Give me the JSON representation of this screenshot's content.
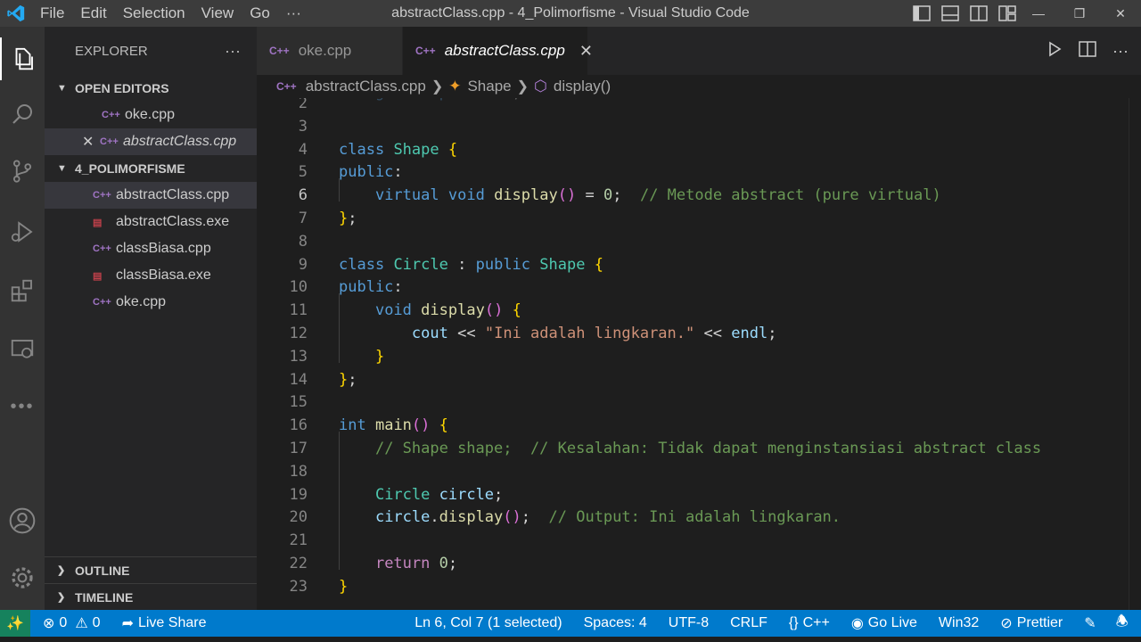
{
  "window": {
    "title": "abstractClass.cpp - 4_Polimorfisme - Visual Studio Code",
    "menu": [
      "File",
      "Edit",
      "Selection",
      "View",
      "Go",
      "···"
    ]
  },
  "sidebar": {
    "header": "EXPLORER",
    "more": "···",
    "open_editors_title": "OPEN EDITORS",
    "open_editors": [
      {
        "name": "oke.cpp",
        "icon": "cpp-file-icon"
      },
      {
        "name": "abstractClass.cpp",
        "icon": "cpp-file-icon"
      }
    ],
    "folder_title": "4_POLIMORFISME",
    "files": [
      {
        "name": "abstractClass.cpp",
        "icon": "cpp-file-icon"
      },
      {
        "name": "abstractClass.exe",
        "icon": "exe-file-icon"
      },
      {
        "name": "classBiasa.cpp",
        "icon": "cpp-file-icon"
      },
      {
        "name": "classBiasa.exe",
        "icon": "exe-file-icon"
      },
      {
        "name": "oke.cpp",
        "icon": "cpp-file-icon"
      }
    ],
    "outline_title": "OUTLINE",
    "timeline_title": "TIMELINE"
  },
  "tabs": [
    {
      "label": "oke.cpp",
      "active": false
    },
    {
      "label": "abstractClass.cpp",
      "active": true
    }
  ],
  "breadcrumb": {
    "file": "abstractClass.cpp",
    "class": "Shape",
    "method": "display()"
  },
  "editor": {
    "line_numbers": [
      "2",
      "3",
      "4",
      "5",
      "6",
      "7",
      "8",
      "9",
      "10",
      "11",
      "12",
      "13",
      "14",
      "15",
      "16",
      "17",
      "18",
      "19",
      "20",
      "21",
      "22",
      "23"
    ],
    "current_line": "6",
    "lines": [
      "using namespace std;",
      "",
      "class Shape {",
      "public:",
      "    virtual void display() = 0;  // Metode abstract (pure virtual)",
      "};",
      "",
      "class Circle : public Shape {",
      "public:",
      "    void display() {",
      "        cout << \"Ini adalah lingkaran.\" << endl;",
      "    }",
      "};",
      "",
      "int main() {",
      "    // Shape shape;  // Kesalahan: Tidak dapat menginstansiasi abstract class",
      "",
      "    Circle circle;",
      "    circle.display();  // Output: Ini adalah lingkaran.",
      "",
      "    return 0;",
      "}"
    ]
  },
  "statusbar": {
    "errors": "0",
    "warnings": "0",
    "live_share": "Live Share",
    "cursor": "Ln 6, Col 7 (1 selected)",
    "spaces": "Spaces: 4",
    "encoding": "UTF-8",
    "eol": "CRLF",
    "language": "C++",
    "language_brace": "{}",
    "go_live": "Go Live",
    "platform": "Win32",
    "prettier": "Prettier"
  },
  "colors": {
    "accent": "#007acc",
    "remote": "#16825d",
    "keyword": "#569cd6",
    "type": "#4ec9b0",
    "function": "#dcdcaa",
    "comment": "#6a9955",
    "string": "#ce9178"
  }
}
